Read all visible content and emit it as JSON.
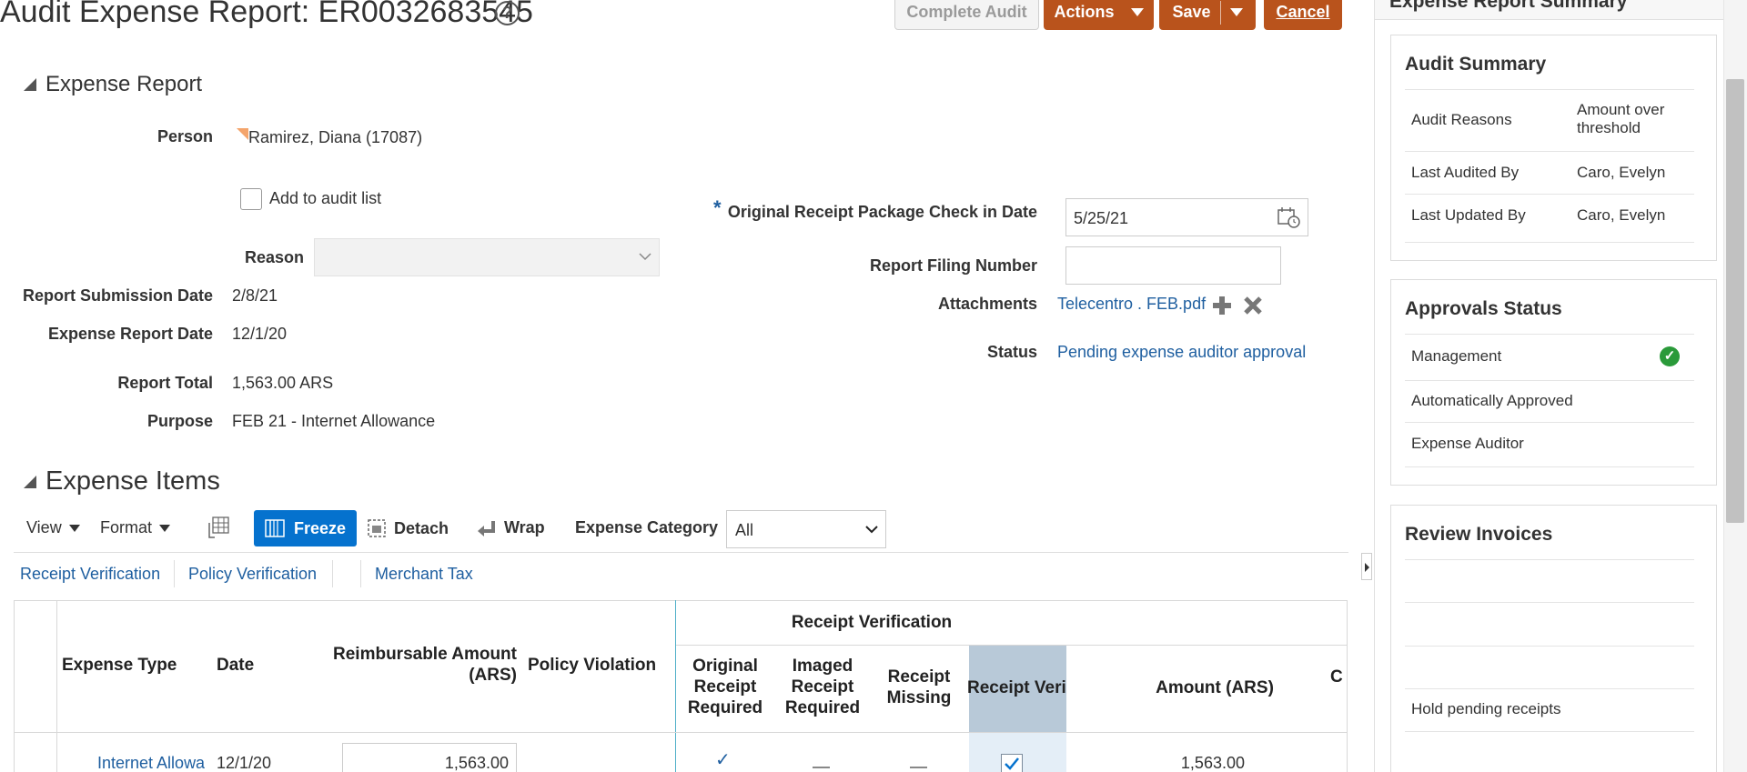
{
  "header": {
    "title": "Audit Expense Report: ER0032683545",
    "help_icon": "question-circle-icon",
    "complete_audit_label": "Complete Audit",
    "actions_label": "Actions",
    "save_label": "Save",
    "cancel_label": "Cancel"
  },
  "expense_report": {
    "section_title": "Expense Report",
    "person_label": "Person",
    "person_value": "Ramirez, Diana (17087)",
    "add_to_audit_label": "Add to audit list",
    "reason_label": "Reason",
    "reason_value": "",
    "submission_date_label": "Report Submission Date",
    "submission_date_value": "2/8/21",
    "expense_report_date_label": "Expense Report Date",
    "expense_report_date_value": "12/1/20",
    "report_total_label": "Report Total",
    "report_total_value": "1,563.00 ARS",
    "purpose_label": "Purpose",
    "purpose_value": "FEB 21 - Internet Allowance",
    "required_marker": "*",
    "receipt_check_label": "Original Receipt Package Check in Date",
    "receipt_check_value": "5/25/21",
    "filing_number_label": "Report Filing Number",
    "filing_number_value": "",
    "attachments_label": "Attachments",
    "attachment_file": "Telecentro . FEB.pdf",
    "status_label": "Status",
    "status_value": "Pending expense auditor approval"
  },
  "expense_items": {
    "section_title": "Expense Items",
    "view_label": "View",
    "format_label": "Format",
    "freeze_label": "Freeze",
    "detach_label": "Detach",
    "wrap_label": "Wrap",
    "category_label": "Expense Category",
    "category_value": "All",
    "tabs": [
      "Receipt Verification",
      "Policy Verification",
      "Merchant Tax"
    ],
    "group_header": "Receipt Verification",
    "columns": {
      "expense_type": "Expense Type",
      "date": "Date",
      "reimbursable_line1": "Reimbursable Amount",
      "reimbursable_line2": "(ARS)",
      "policy_violation": "Policy Violation",
      "orig_receipt_1": "Original",
      "orig_receipt_2": "Receipt",
      "orig_receipt_3": "Required",
      "imaged_receipt_1": "Imaged",
      "imaged_receipt_2": "Receipt",
      "imaged_receipt_3": "Required",
      "receipt_missing_1": "Receipt",
      "receipt_missing_2": "Missing",
      "receipt_verified": "Receipt Veri",
      "amount": "Amount (ARS)",
      "cut_col": "C"
    },
    "rows": [
      {
        "expense_type": "Internet Allowa",
        "date": "12/1/20",
        "reimbursable": "1,563.00",
        "amount": "1,563.00"
      }
    ]
  },
  "side_panel": {
    "title": "Expense Report Summary",
    "audit_summary": {
      "title": "Audit Summary",
      "rows": [
        {
          "label": "Audit Reasons",
          "value": "Amount over threshold"
        },
        {
          "label": "Last Audited By",
          "value": "Caro, Evelyn"
        },
        {
          "label": "Last Updated By",
          "value": "Caro, Evelyn"
        }
      ]
    },
    "approvals": {
      "title": "Approvals Status",
      "rows": [
        "Management",
        "Automatically Approved",
        "Expense Auditor"
      ]
    },
    "review_invoices": {
      "title": "Review Invoices",
      "rows": [
        "",
        "",
        "",
        "Hold pending receipts"
      ]
    }
  },
  "colors": {
    "brand_orange": "#b9531c",
    "freeze_blue": "#0572ce",
    "link_blue": "#1f5fa0",
    "success_green": "#2a9a3a"
  }
}
